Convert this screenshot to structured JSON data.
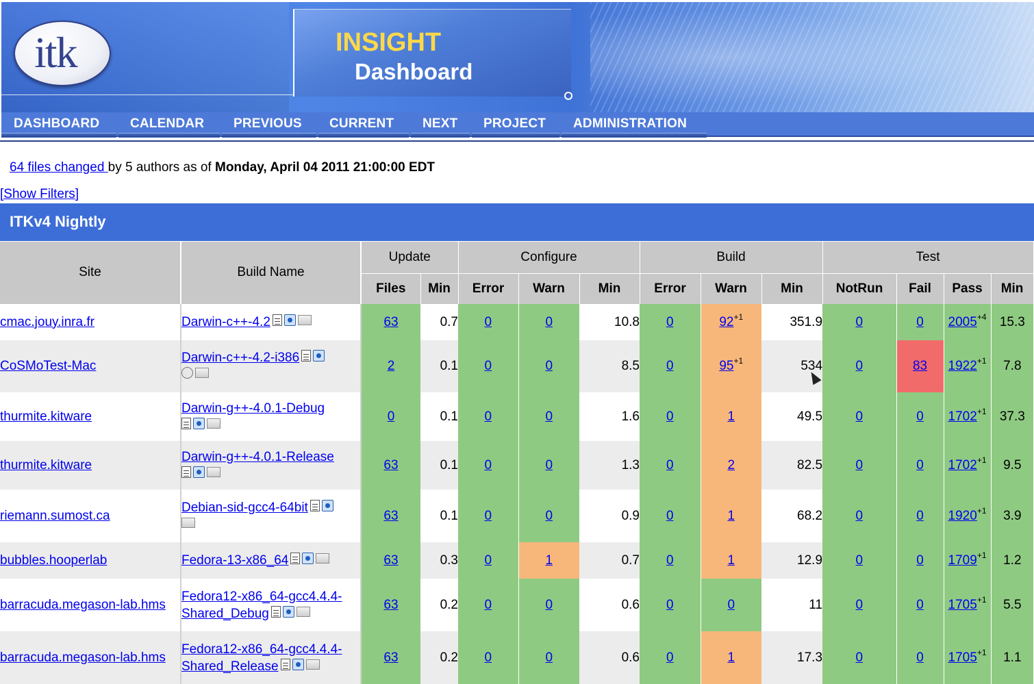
{
  "banner": {
    "title_line1": "INSIGHT",
    "title_line2": "Dashboard",
    "logo_text": "itk"
  },
  "nav": [
    "DASHBOARD",
    "CALENDAR",
    "PREVIOUS",
    "CURRENT",
    "NEXT",
    "PROJECT",
    "ADMINISTRATION"
  ],
  "info": {
    "files_changed": "64 files changed ",
    "authors": "by 5 authors as of ",
    "date": "Monday, April 04 2011 21:00:00 EDT"
  },
  "filters_label": "[Show Filters]",
  "section_title": "ITKv4 Nightly",
  "table": {
    "site_header": "Site",
    "build_header": "Build Name",
    "groups": [
      "Update",
      "Configure",
      "Build",
      "Test"
    ],
    "subheaders": [
      "Files",
      "Min",
      "Error",
      "Warn",
      "Min",
      "Error",
      "Warn",
      "Min",
      "NotRun",
      "Fail",
      "Pass",
      "Min"
    ],
    "rows": [
      {
        "site": "cmac.jouy.inra.fr",
        "build": "Darwin-c++-4.2",
        "files": "63",
        "upd_min": "0.7",
        "cfg_err": "0",
        "cfg_warn": "0",
        "cfg_min": "10.8",
        "bld_err": "0",
        "bld_warn": "92",
        "bld_warn_delta": "+1",
        "bld_min": "351.9",
        "notrun": "0",
        "fail": "0",
        "pass": "2005",
        "pass_delta": "+4",
        "test_min": "15.3"
      },
      {
        "site": "CoSMoTest-Mac",
        "build": "Darwin-c++-4.2-i386",
        "files": "2",
        "upd_min": "0.1",
        "cfg_err": "0",
        "cfg_warn": "0",
        "cfg_min": "8.5",
        "bld_err": "0",
        "bld_warn": "95",
        "bld_warn_delta": "+1",
        "bld_min": "534",
        "notrun": "0",
        "fail": "83",
        "pass": "1922",
        "pass_delta": "+1",
        "test_min": "7.8"
      },
      {
        "site": "thurmite.kitware",
        "build": "Darwin-g++-4.0.1-Debug",
        "files": "0",
        "upd_min": "0.1",
        "cfg_err": "0",
        "cfg_warn": "0",
        "cfg_min": "1.6",
        "bld_err": "0",
        "bld_warn": "1",
        "bld_warn_delta": "",
        "bld_min": "49.5",
        "notrun": "0",
        "fail": "0",
        "pass": "1702",
        "pass_delta": "+1",
        "test_min": "37.3"
      },
      {
        "site": "thurmite.kitware",
        "build": "Darwin-g++-4.0.1-Release",
        "files": "63",
        "upd_min": "0.1",
        "cfg_err": "0",
        "cfg_warn": "0",
        "cfg_min": "1.3",
        "bld_err": "0",
        "bld_warn": "2",
        "bld_warn_delta": "",
        "bld_min": "82.5",
        "notrun": "0",
        "fail": "0",
        "pass": "1702",
        "pass_delta": "+1",
        "test_min": "9.5"
      },
      {
        "site": "riemann.sumost.ca",
        "build": "Debian-sid-gcc4-64bit",
        "files": "63",
        "upd_min": "0.1",
        "cfg_err": "0",
        "cfg_warn": "0",
        "cfg_min": "0.9",
        "bld_err": "0",
        "bld_warn": "1",
        "bld_warn_delta": "",
        "bld_min": "68.2",
        "notrun": "0",
        "fail": "0",
        "pass": "1920",
        "pass_delta": "+1",
        "test_min": "3.9"
      },
      {
        "site": "bubbles.hooperlab",
        "build": "Fedora-13-x86_64",
        "files": "63",
        "upd_min": "0.3",
        "cfg_err": "0",
        "cfg_warn": "1",
        "cfg_min": "0.7",
        "bld_err": "0",
        "bld_warn": "1",
        "bld_warn_delta": "",
        "bld_min": "12.9",
        "notrun": "0",
        "fail": "0",
        "pass": "1709",
        "pass_delta": "+1",
        "test_min": "1.2"
      },
      {
        "site": "barracuda.megason-lab.hms",
        "build": "Fedora12-x86_64-gcc4.4.4-Shared_Debug",
        "files": "63",
        "upd_min": "0.2",
        "cfg_err": "0",
        "cfg_warn": "0",
        "cfg_min": "0.6",
        "bld_err": "0",
        "bld_warn": "0",
        "bld_warn_delta": "",
        "bld_min": "11",
        "notrun": "0",
        "fail": "0",
        "pass": "1705",
        "pass_delta": "+1",
        "test_min": "5.5"
      },
      {
        "site": "barracuda.megason-lab.hms",
        "build": "Fedora12-x86_64-gcc4.4.4-Shared_Release",
        "files": "63",
        "upd_min": "0.2",
        "cfg_err": "0",
        "cfg_warn": "0",
        "cfg_min": "0.6",
        "bld_err": "0",
        "bld_warn": "1",
        "bld_warn_delta": "",
        "bld_min": "17.3",
        "notrun": "0",
        "fail": "0",
        "pass": "1705",
        "pass_delta": "+1",
        "test_min": "1.1"
      }
    ]
  },
  "colors": {
    "ok": "#8fca83",
    "warn": "#f8b77a",
    "fail": "#f26b6b",
    "header_blue": "#3d6dd6"
  }
}
